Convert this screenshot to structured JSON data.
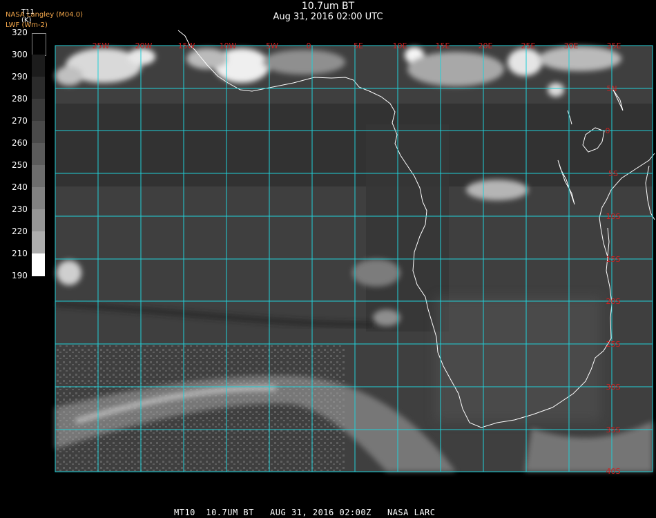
{
  "header": {
    "title": "10.7um BT",
    "subtitle": "Aug 31, 2016 02:00 UTC",
    "org_line1": "NASA Langley (M04.0)",
    "org_line2": "LWF (Wm-2)",
    "var_line1": "T11",
    "var_line2": "(K)"
  },
  "legend": {
    "labels": [
      "320",
      "300",
      "290",
      "280",
      "270",
      "260",
      "250",
      "240",
      "230",
      "220",
      "210",
      "190"
    ],
    "colors": [
      "#000000",
      "#1c1c1c",
      "#2b2b2b",
      "#3a3a3a",
      "#4a4a4a",
      "#5b5b5b",
      "#6d6d6d",
      "#818181",
      "#969696",
      "#adadad",
      "#c6c6c6",
      "#e2e2e2",
      "#ffffff"
    ]
  },
  "map": {
    "lon_labels": [
      "25W",
      "20W",
      "15W",
      "10W",
      "5W",
      "0",
      "5E",
      "10E",
      "15E",
      "20E",
      "25E",
      "30E",
      "35E"
    ],
    "lat_labels": [
      "5N",
      "0",
      "5S",
      "10S",
      "15S",
      "20S",
      "25S",
      "30S",
      "35S",
      "40S"
    ],
    "grid_color": "#20d0d8",
    "label_color": "#d02020",
    "coast_color": "#ffffff"
  },
  "footer": "MT10  10.7UM BT   AUG 31, 2016 02:00Z   NASA LARC"
}
